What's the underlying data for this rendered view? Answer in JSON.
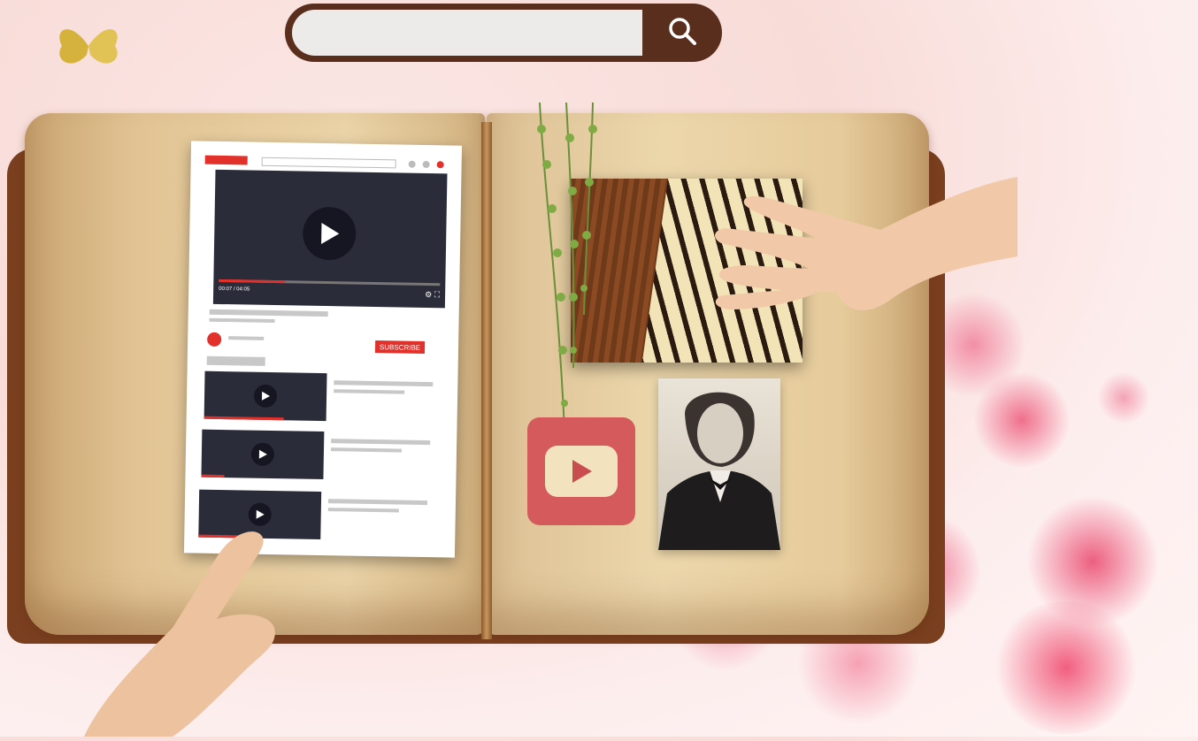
{
  "search": {
    "placeholder": "",
    "value": ""
  },
  "icons": {
    "search": "search-icon",
    "play": "play-icon",
    "youtube": "youtube-logo",
    "butterfly": "butterfly-icon"
  },
  "yt_mock": {
    "subscribe_label": "SUBSCRIBE",
    "time_label": "00:07 / 04:05",
    "progress": 0.3
  },
  "colors": {
    "search_frame": "#5a2e1c",
    "youtube_red": "#e2312b",
    "logo_red": "#d45a5c",
    "page": "#ead3a7"
  }
}
